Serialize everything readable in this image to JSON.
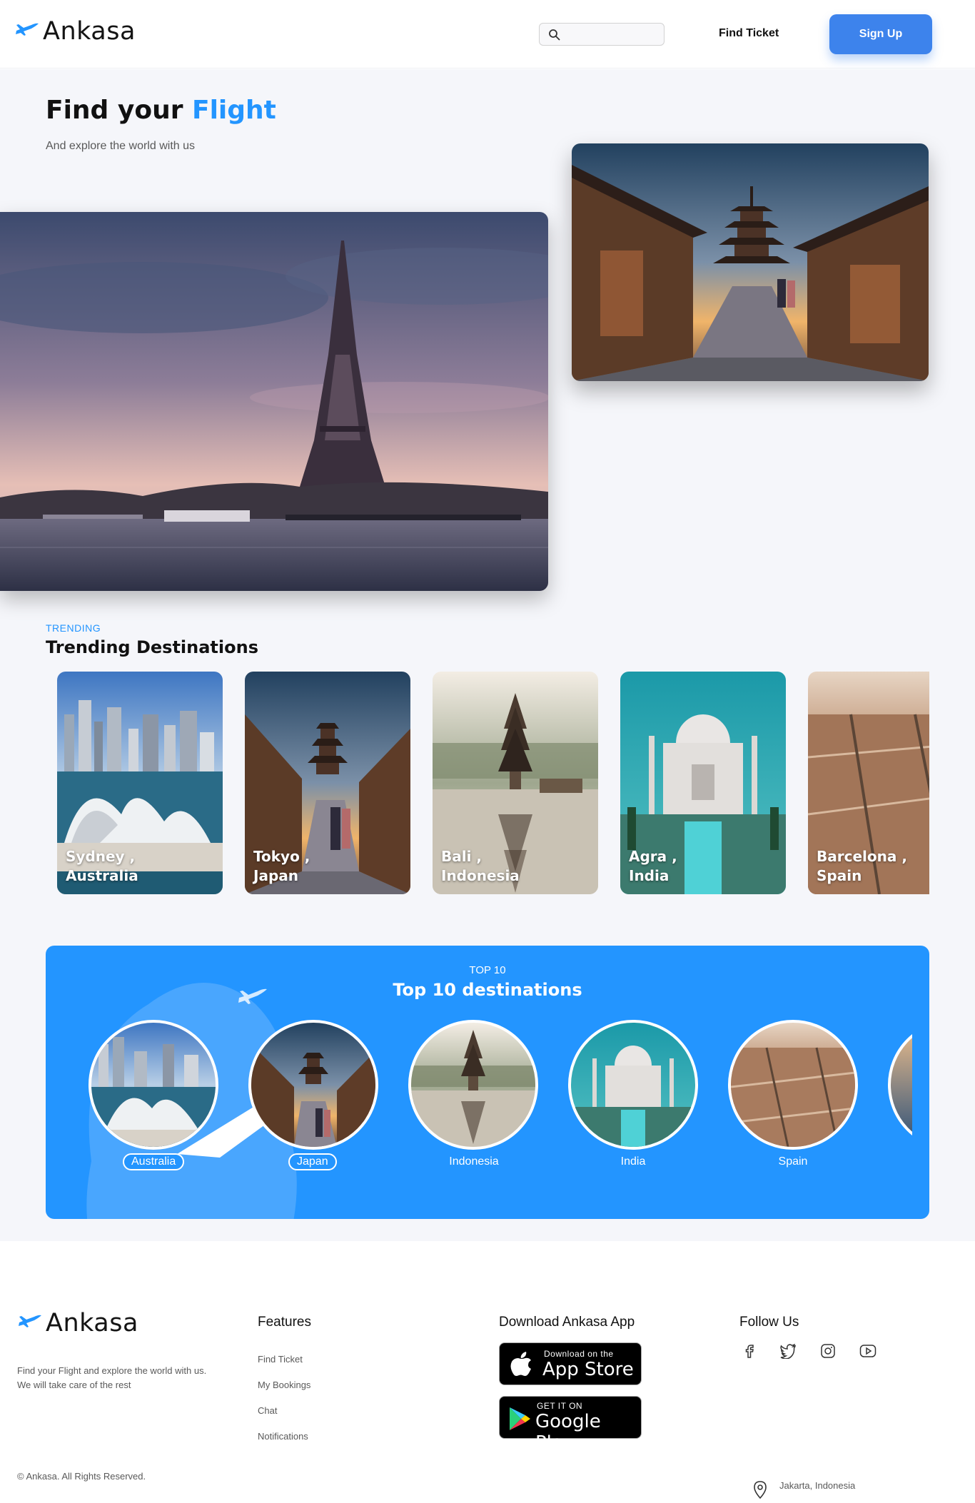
{
  "header": {
    "logo_text": "Ankasa",
    "search_placeholder": "",
    "nav_find_ticket": "Find Ticket",
    "signup_label": "Sign Up"
  },
  "hero": {
    "title_part1": "Find your ",
    "title_accent": "Flight",
    "subtitle": "And explore the world with us"
  },
  "trending": {
    "label": "TRENDING",
    "title": "Trending Destinations",
    "cards": [
      {
        "city": "Sydney ,",
        "country": "Australia"
      },
      {
        "city": "Tokyo ,",
        "country": "Japan"
      },
      {
        "city": "Bali ,",
        "country": "Indonesia"
      },
      {
        "city": "Agra ,",
        "country": "India"
      },
      {
        "city": "Barcelona ,",
        "country": "Spain"
      }
    ]
  },
  "top10": {
    "label": "TOP 10",
    "title": "Top 10 destinations",
    "items": [
      "Australia",
      "Japan",
      "Indonesia",
      "India",
      "Spain"
    ]
  },
  "footer": {
    "logo_text": "Ankasa",
    "description_line1": "Find your Flight and explore the world with us.",
    "description_line2": "We will take care of the rest",
    "copyright": "© Ankasa. All Rights Reserved.",
    "features_title": "Features",
    "features": [
      "Find Ticket",
      "My Bookings",
      "Chat",
      "Notifications"
    ],
    "download_title": "Download Ankasa App",
    "appstore_small": "Download on the",
    "appstore_big": "App Store",
    "googleplay_small": "GET IT ON",
    "googleplay_big": "Google Play",
    "follow_title": "Follow Us",
    "location": "Jakarta, Indonesia"
  },
  "colors": {
    "accent": "#2395ff",
    "button": "#3d83ec",
    "hero_bg": "#f5f6fa"
  },
  "icons": [
    "plane-logo-icon",
    "search-icon",
    "facebook-icon",
    "twitter-icon",
    "instagram-icon",
    "youtube-icon",
    "apple-icon",
    "google-play-icon",
    "location-pin-icon"
  ]
}
